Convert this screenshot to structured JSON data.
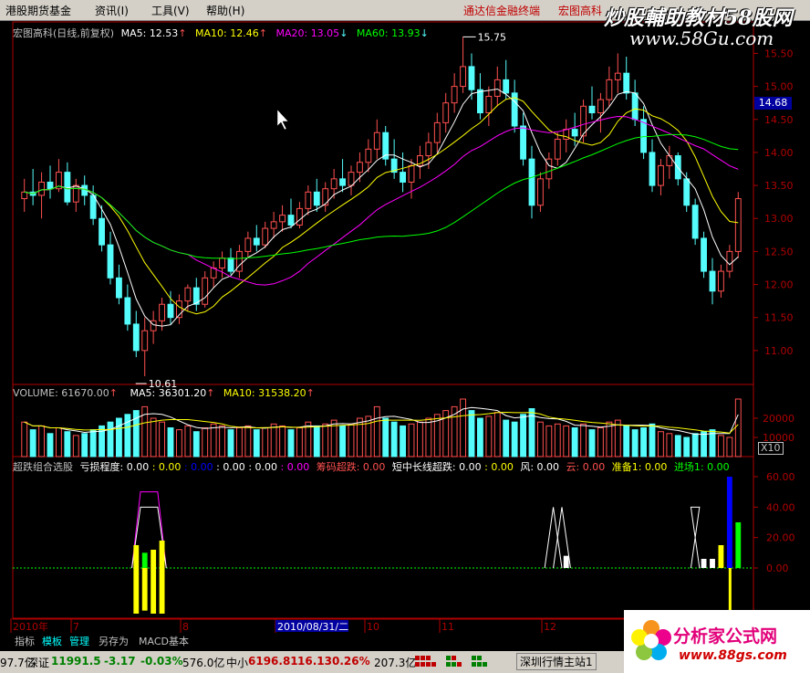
{
  "menubar": {
    "items": [
      "港股期货基金",
      "资讯(I)",
      "工具(V)",
      "帮助(H)"
    ],
    "links": [
      "通达信金融终端",
      "宏图高科"
    ]
  },
  "watermark": {
    "title": "炒股輔助教材58股网",
    "url": "www.58Gu.com"
  },
  "logo": {
    "title": "分析家公式网",
    "url": "www.88gs.com"
  },
  "colors": {
    "up": "#ff5050",
    "down": "#54fcfc",
    "ma5": "#ffffff",
    "ma10": "#ffff00",
    "ma20": "#ff00ff",
    "ma60": "#00ff00",
    "axis": "#b00000",
    "blue": "#0000ff",
    "green": "#00ff00"
  },
  "price_panel": {
    "name": "宏图高科(日线,前复权)",
    "ma": [
      {
        "label": "MA5",
        "value": "12.53",
        "arrow": "↑"
      },
      {
        "label": "MA10",
        "value": "12.46",
        "arrow": "↑"
      },
      {
        "label": "MA20",
        "value": "13.05",
        "arrow": "↓"
      },
      {
        "label": "MA60",
        "value": "13.93",
        "arrow": "↓"
      }
    ],
    "current_price": "14.68",
    "high_mark": "15.75",
    "low_mark": "10.61",
    "y_ticks": [
      "15.50",
      "15.00",
      "14.50",
      "14.00",
      "13.50",
      "13.00",
      "12.50",
      "12.00",
      "11.50",
      "11.00"
    ]
  },
  "volume_panel": {
    "label": "VOLUME",
    "value": "61670.00",
    "ma5": "36301.20",
    "ma10": "31538.20",
    "y_ticks": [
      "20000",
      "10000"
    ],
    "unit": "X10"
  },
  "indicator_panel": {
    "name": "超跌组合选股",
    "items": [
      {
        "label": "亏损程度",
        "value": "0.00"
      },
      {
        "label": "",
        "value": "0.00"
      },
      {
        "label": "",
        "value": "0.00"
      },
      {
        "label": "",
        "value": "0.00"
      },
      {
        "label": "",
        "value": "0.00"
      },
      {
        "label": "",
        "value": "0.00"
      },
      {
        "label": "筹码超跌",
        "value": "0.00"
      },
      {
        "label": "短中长线超跌",
        "value": "0.00"
      },
      {
        "label": "",
        "value": "0.00"
      },
      {
        "label": "风",
        "value": "0.00"
      },
      {
        "label": "云",
        "value": "0.00"
      },
      {
        "label": "准备1",
        "value": "0.00"
      },
      {
        "label": "进场1",
        "value": "0.00"
      }
    ],
    "y_ticks": [
      "60.00",
      "40.00",
      "20.00",
      "0.00"
    ]
  },
  "x_axis": {
    "labels": [
      "2010年",
      "7",
      "8",
      "2010/08/31/二",
      "10",
      "11",
      "12"
    ]
  },
  "tabs": [
    "指标",
    "模板",
    "管理",
    "另存为",
    "MACD基本"
  ],
  "statusbar": {
    "left_volume": "97.7亿",
    "sz_name": "深证",
    "sz_value": "11991.5",
    "sz_change": "-3.17",
    "sz_pct": "-0.03%",
    "sz_amount": "576.0亿",
    "zx_name": "中小",
    "zx_value": "6196.81",
    "zx_change": "16.13",
    "zx_pct": "0.26%",
    "zx_amount": "207.3亿",
    "station": "深圳行情主站1"
  },
  "chart_data": {
    "type": "candlestick",
    "note_units": "price in CNY, volume in lots",
    "ylim": [
      10.5,
      15.7
    ],
    "candles": [
      [
        13.3,
        13.6,
        13.1,
        13.4
      ],
      [
        13.4,
        13.75,
        13.2,
        13.35
      ],
      [
        13.35,
        13.7,
        13.0,
        13.55
      ],
      [
        13.55,
        13.8,
        13.3,
        13.45
      ],
      [
        13.45,
        13.9,
        13.4,
        13.7
      ],
      [
        13.7,
        13.85,
        13.2,
        13.25
      ],
      [
        13.25,
        13.6,
        13.1,
        13.5
      ],
      [
        13.5,
        13.65,
        13.2,
        13.35
      ],
      [
        13.35,
        13.5,
        12.9,
        13.0
      ],
      [
        13.0,
        13.2,
        12.5,
        12.6
      ],
      [
        12.6,
        12.8,
        12.0,
        12.1
      ],
      [
        12.1,
        12.3,
        11.7,
        11.8
      ],
      [
        11.8,
        12.0,
        11.3,
        11.4
      ],
      [
        11.4,
        11.6,
        10.9,
        11.0
      ],
      [
        11.0,
        11.5,
        10.61,
        11.3
      ],
      [
        11.3,
        11.6,
        11.1,
        11.45
      ],
      [
        11.45,
        11.8,
        11.3,
        11.7
      ],
      [
        11.7,
        11.9,
        11.4,
        11.5
      ],
      [
        11.5,
        11.85,
        11.4,
        11.75
      ],
      [
        11.75,
        12.0,
        11.6,
        11.95
      ],
      [
        11.95,
        12.1,
        11.6,
        11.7
      ],
      [
        11.7,
        12.2,
        11.65,
        12.1
      ],
      [
        12.1,
        12.35,
        11.95,
        12.25
      ],
      [
        12.25,
        12.5,
        12.1,
        12.4
      ],
      [
        12.4,
        12.55,
        12.15,
        12.2
      ],
      [
        12.2,
        12.6,
        12.1,
        12.5
      ],
      [
        12.5,
        12.8,
        12.4,
        12.7
      ],
      [
        12.7,
        12.9,
        12.5,
        12.6
      ],
      [
        12.6,
        12.95,
        12.55,
        12.85
      ],
      [
        12.85,
        13.1,
        12.7,
        12.95
      ],
      [
        12.95,
        13.2,
        12.8,
        13.05
      ],
      [
        13.05,
        13.3,
        12.85,
        12.9
      ],
      [
        12.9,
        13.25,
        12.85,
        13.15
      ],
      [
        13.15,
        13.5,
        13.05,
        13.4
      ],
      [
        13.4,
        13.6,
        13.1,
        13.2
      ],
      [
        13.2,
        13.55,
        13.1,
        13.45
      ],
      [
        13.45,
        13.75,
        13.3,
        13.6
      ],
      [
        13.6,
        13.9,
        13.4,
        13.5
      ],
      [
        13.5,
        13.8,
        13.35,
        13.7
      ],
      [
        13.7,
        14.0,
        13.55,
        13.85
      ],
      [
        13.85,
        14.2,
        13.7,
        14.05
      ],
      [
        14.05,
        14.5,
        13.9,
        14.3
      ],
      [
        14.3,
        14.4,
        13.8,
        13.9
      ],
      [
        13.9,
        14.2,
        13.6,
        13.7
      ],
      [
        13.7,
        14.0,
        13.4,
        13.55
      ],
      [
        13.55,
        13.9,
        13.3,
        13.8
      ],
      [
        13.8,
        14.1,
        13.6,
        13.95
      ],
      [
        13.95,
        14.3,
        13.75,
        14.15
      ],
      [
        14.15,
        14.6,
        14.0,
        14.45
      ],
      [
        14.45,
        14.9,
        14.3,
        14.75
      ],
      [
        14.75,
        15.2,
        14.6,
        15.0
      ],
      [
        15.0,
        15.75,
        14.9,
        15.3
      ],
      [
        15.3,
        15.5,
        14.8,
        14.95
      ],
      [
        14.95,
        15.2,
        14.5,
        14.6
      ],
      [
        14.6,
        15.0,
        14.4,
        14.85
      ],
      [
        14.85,
        15.3,
        14.7,
        15.1
      ],
      [
        15.1,
        15.4,
        14.8,
        14.9
      ],
      [
        14.9,
        15.1,
        14.3,
        14.4
      ],
      [
        14.4,
        14.6,
        13.8,
        13.9
      ],
      [
        13.9,
        14.1,
        13.0,
        13.2
      ],
      [
        13.2,
        13.7,
        13.1,
        13.6
      ],
      [
        13.6,
        14.0,
        13.45,
        13.9
      ],
      [
        13.9,
        14.3,
        13.8,
        14.2
      ],
      [
        14.2,
        14.5,
        14.0,
        14.35
      ],
      [
        14.35,
        14.6,
        14.1,
        14.25
      ],
      [
        14.25,
        14.8,
        14.15,
        14.7
      ],
      [
        14.7,
        15.0,
        14.5,
        14.6
      ],
      [
        14.6,
        14.9,
        14.3,
        14.8
      ],
      [
        14.8,
        15.3,
        14.7,
        15.1
      ],
      [
        15.1,
        15.5,
        14.9,
        15.2
      ],
      [
        15.2,
        15.45,
        14.8,
        14.9
      ],
      [
        14.9,
        15.1,
        14.4,
        14.5
      ],
      [
        14.5,
        14.7,
        13.9,
        14.0
      ],
      [
        14.0,
        14.2,
        13.4,
        13.5
      ],
      [
        13.5,
        13.9,
        13.35,
        13.8
      ],
      [
        13.8,
        14.1,
        13.6,
        13.95
      ],
      [
        13.95,
        14.0,
        13.5,
        13.6
      ],
      [
        13.6,
        13.7,
        13.1,
        13.2
      ],
      [
        13.2,
        13.3,
        12.6,
        12.7
      ],
      [
        12.7,
        12.8,
        12.1,
        12.2
      ],
      [
        12.2,
        12.4,
        11.7,
        11.9
      ],
      [
        11.9,
        12.3,
        11.8,
        12.2
      ],
      [
        12.2,
        12.6,
        12.1,
        12.5
      ],
      [
        12.5,
        13.4,
        12.4,
        13.3
      ]
    ],
    "volume": [
      18000,
      14000,
      16000,
      12000,
      15000,
      13000,
      11000,
      12000,
      14000,
      16000,
      18000,
      20000,
      22000,
      24000,
      26000,
      20000,
      18000,
      15000,
      14000,
      16000,
      13000,
      15000,
      17000,
      16000,
      14000,
      15000,
      16000,
      14000,
      15000,
      17000,
      16000,
      14000,
      15000,
      18000,
      16000,
      17000,
      19000,
      16000,
      17000,
      20000,
      21000,
      26000,
      20000,
      18000,
      16000,
      17000,
      18000,
      20000,
      22000,
      24000,
      26000,
      32000,
      24000,
      20000,
      21000,
      23000,
      19000,
      18000,
      22000,
      25000,
      18000,
      16000,
      17000,
      16000,
      15000,
      17000,
      14000,
      15000,
      18000,
      19000,
      16000,
      14000,
      15000,
      17000,
      13000,
      12000,
      11000,
      10000,
      12000,
      13000,
      14000,
      11000,
      10000,
      61670
    ],
    "indicator_lines": {
      "white": "pulses at bars 13-16, 49-51, 62, 75",
      "blue_bar_peak": 60,
      "green_bar_peak": 30
    }
  }
}
